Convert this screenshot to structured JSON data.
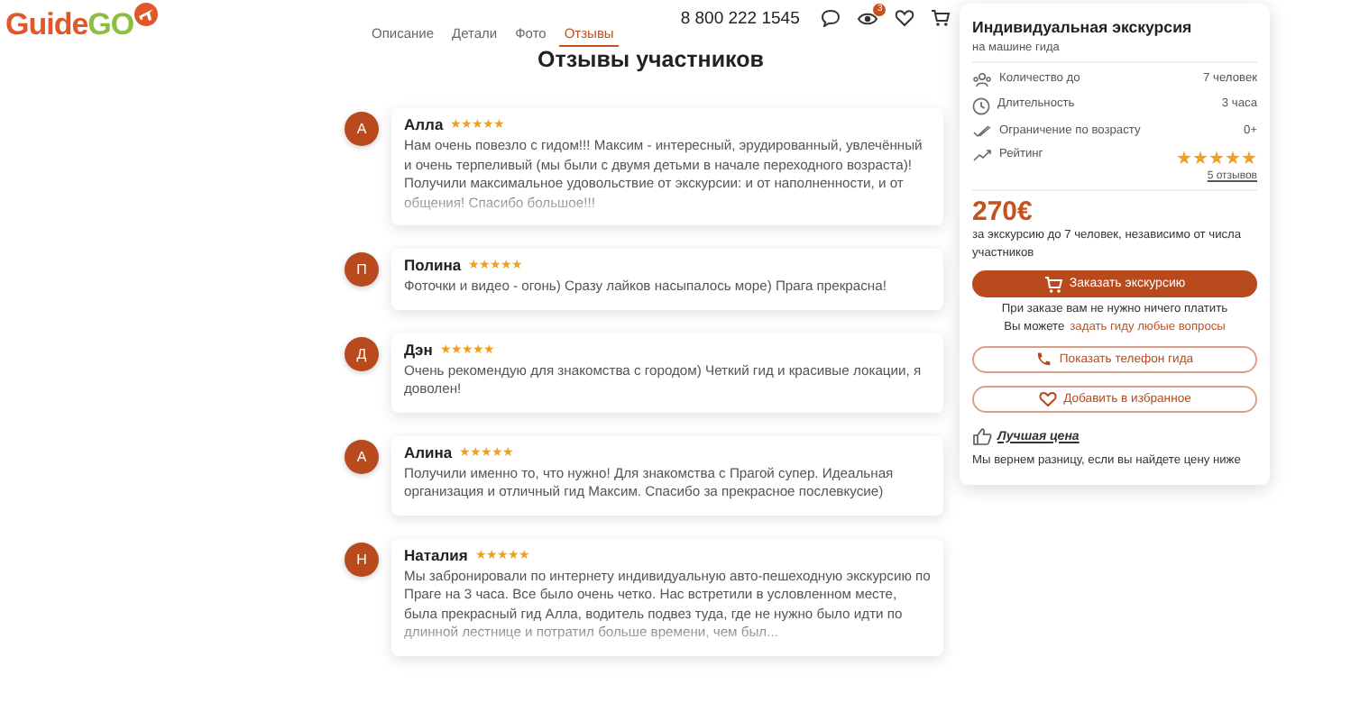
{
  "logo": {
    "first": "Guide",
    "second": "GO"
  },
  "tabs": [
    {
      "label": "Описание",
      "selected": false
    },
    {
      "label": "Детали",
      "selected": false
    },
    {
      "label": "Фото",
      "selected": false
    },
    {
      "label": "Отзывы",
      "selected": true
    }
  ],
  "phone": "8 800 222 1545",
  "header_badge": "3",
  "title": "Отзывы участников",
  "reviews": [
    {
      "initial": "А",
      "name": "Алла",
      "stars": 5,
      "faded": true,
      "text": "Нам очень повезло с гидом!!! Максим - интересный, эрудированный, увлечённый и очень терпеливый (мы были с двумя детьми в начале переходного возраста)! Получили максимальное удовольствие от экскурсии: и от наполненности, и от общения! Спасибо большое!!!"
    },
    {
      "initial": "П",
      "name": "Полина",
      "stars": 5,
      "faded": false,
      "text": "Фоточки и видео - огонь) Сразу лайков насыпалось море) Прага прекрасна!"
    },
    {
      "initial": "Д",
      "name": "Дэн",
      "stars": 5,
      "faded": false,
      "text": "Очень рекомендую для знакомства с городом) Четкий гид и красивые локации, я доволен!"
    },
    {
      "initial": "А",
      "name": "Алина",
      "stars": 5,
      "faded": false,
      "text": "Получили именно то, что нужно! Для знакомства с Прагой супер. Идеальная организация и отличный гид Максим. Спасибо за прекрасное послевкусие)"
    },
    {
      "initial": "Н",
      "name": "Наталия",
      "stars": 5,
      "faded": true,
      "text": "Мы забронировали по интернету индивидуальную авто-пешеходную экскурсию по Праге на 3 часа. Все было очень четко. Нас встретили в условленном месте, была прекрасный гид Алла, водитель подвез туда, где не нужно было идти по длинной лестнице и потратил больше времени, чем был..."
    }
  ],
  "panel": {
    "title": "Индивидуальная экскурсия",
    "subtitle": "на машине гида",
    "facts": [
      {
        "kind": "text",
        "label": "Количество до",
        "value": "7 человек"
      },
      {
        "kind": "text",
        "label": "Длительность",
        "value": "3 часа"
      },
      {
        "kind": "text",
        "label": "Ограничение по возрасту",
        "value": "0+"
      },
      {
        "kind": "rating",
        "label": "Рейтинг",
        "stars": 5,
        "link": "5 отзывов"
      }
    ],
    "price": "270€",
    "price_note": "за экскурсию до 7 человек, независимо от числа участников",
    "order_button": "Заказать экскурсию",
    "note": "При заказе вам не нужно ничего платить",
    "ask_prefix": "Вы можете",
    "ask_link": "задать гиду любые вопросы",
    "phone_button": "Показать телефон гида",
    "favorite_button": "Добавить в избранное",
    "best_price": "Лучшая цена",
    "best_price_note": "Мы вернем разницу, если вы найдете цену ниже"
  }
}
